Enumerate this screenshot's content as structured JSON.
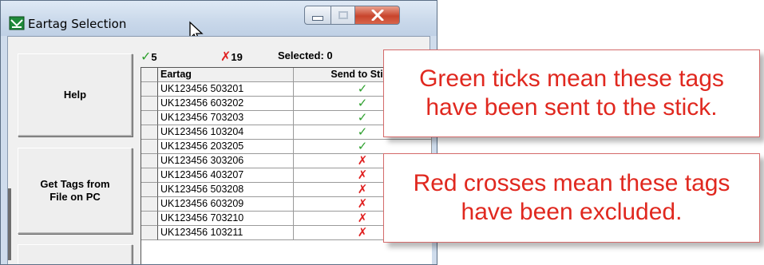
{
  "window": {
    "title": "Eartag Selection",
    "controls": {
      "minimize": "minimize",
      "maximize": "maximize",
      "close": "close"
    }
  },
  "sidebar": {
    "buttons": [
      {
        "label": "Help"
      },
      {
        "label": "Get Tags from\nFile on PC"
      },
      {
        "label": ""
      }
    ]
  },
  "summary": {
    "tick_count": "5",
    "cross_count": "19",
    "selected_label": "Selected: 0"
  },
  "grid": {
    "columns": [
      "Eartag",
      "Send to Stick"
    ],
    "rows": [
      {
        "eartag": "UK123456 503201",
        "send": "tick"
      },
      {
        "eartag": "UK123456 603202",
        "send": "tick"
      },
      {
        "eartag": "UK123456 703203",
        "send": "tick"
      },
      {
        "eartag": "UK123456 103204",
        "send": "tick"
      },
      {
        "eartag": "UK123456 203205",
        "send": "tick"
      },
      {
        "eartag": "UK123456 303206",
        "send": "cross"
      },
      {
        "eartag": "UK123456 403207",
        "send": "cross"
      },
      {
        "eartag": "UK123456 503208",
        "send": "cross"
      },
      {
        "eartag": "UK123456 603209",
        "send": "cross"
      },
      {
        "eartag": "UK123456 703210",
        "send": "cross"
      },
      {
        "eartag": "UK123456 103211",
        "send": "cross"
      }
    ]
  },
  "callouts": [
    {
      "line1": "Green ticks mean these tags",
      "line2": "have been sent to the stick."
    },
    {
      "line1": "Red crosses mean these tags",
      "line2": "have been excluded."
    }
  ],
  "colors": {
    "tick": "#2ea02e",
    "cross": "#e02020",
    "callout_text": "#e0281f"
  },
  "icons": {
    "tick": "✓",
    "cross": "✗"
  }
}
